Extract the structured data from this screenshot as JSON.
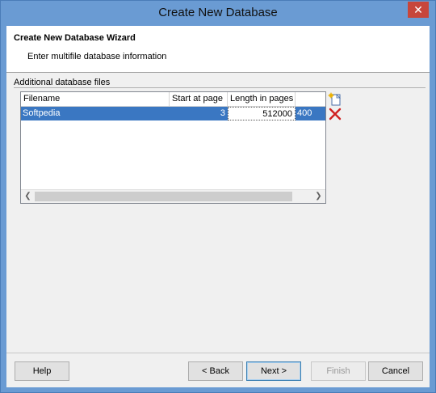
{
  "window": {
    "title": "Create New Database",
    "close_glyph": "✕"
  },
  "header": {
    "title": "Create New Database Wizard",
    "subtitle": "Enter multifile database information"
  },
  "section": {
    "label": "Additional database files"
  },
  "grid": {
    "columns": [
      "Filename",
      "Start at page",
      "Length in pages",
      ""
    ],
    "rows": [
      {
        "filename": "Softpedia",
        "start": "3",
        "length": "512000",
        "extra": "400"
      }
    ]
  },
  "side_icons": [
    "new-file-icon",
    "delete-icon"
  ],
  "buttons": {
    "help": "Help",
    "back": "< Back",
    "next": "Next >",
    "finish": "Finish",
    "cancel": "Cancel"
  }
}
